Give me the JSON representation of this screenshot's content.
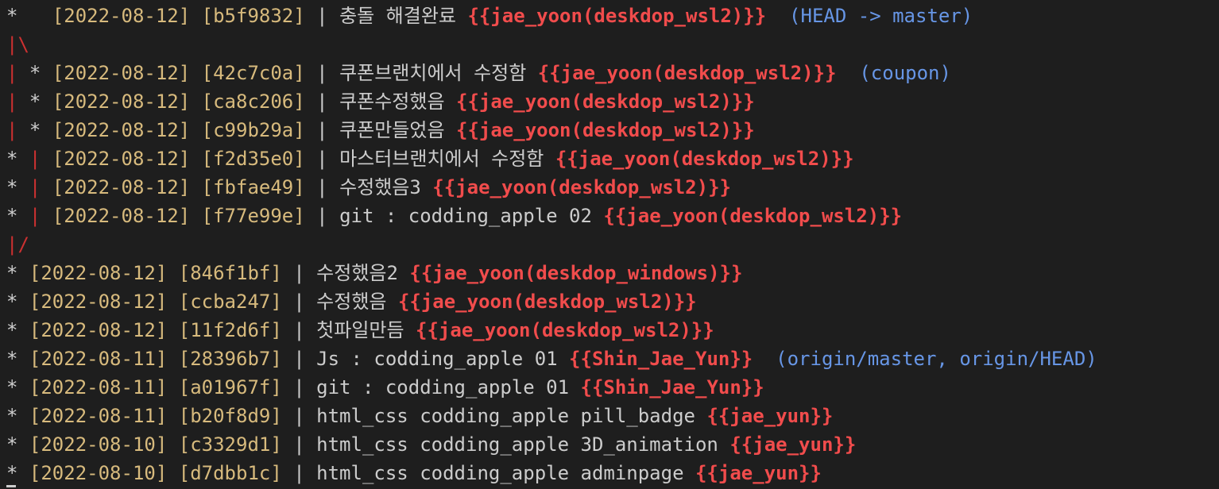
{
  "terminal": {
    "lines": [
      {
        "graph": "*  ",
        "graph_color": "default",
        "date": "[2022-08-12]",
        "hash": "[b5f9832]",
        "sep": "|",
        "message": "충돌 해결완료",
        "author": "{{jae_yoon(deskdop_wsl2)}}",
        "ref": "(HEAD -> master)"
      },
      {
        "graph": "|\\",
        "graph_color": "red",
        "date": "",
        "hash": "",
        "sep": "",
        "message": "",
        "author": "",
        "ref": ""
      },
      {
        "graph": "| *",
        "graph_color": "red-first",
        "date": "[2022-08-12]",
        "hash": "[42c7c0a]",
        "sep": "|",
        "message": "쿠폰브랜치에서 수정함",
        "author": "{{jae_yoon(deskdop_wsl2)}}",
        "ref": "(coupon)"
      },
      {
        "graph": "| *",
        "graph_color": "red-first",
        "date": "[2022-08-12]",
        "hash": "[ca8c206]",
        "sep": "|",
        "message": "쿠폰수정했음",
        "author": "{{jae_yoon(deskdop_wsl2)}}",
        "ref": ""
      },
      {
        "graph": "| *",
        "graph_color": "red-first",
        "date": "[2022-08-12]",
        "hash": "[c99b29a]",
        "sep": "|",
        "message": "쿠폰만들었음",
        "author": "{{jae_yoon(deskdop_wsl2)}}",
        "ref": ""
      },
      {
        "graph": "* |",
        "graph_color": "red-last",
        "date": "[2022-08-12]",
        "hash": "[f2d35e0]",
        "sep": "|",
        "message": "마스터브랜치에서 수정함",
        "author": "{{jae_yoon(deskdop_wsl2)}}",
        "ref": ""
      },
      {
        "graph": "* |",
        "graph_color": "red-last",
        "date": "[2022-08-12]",
        "hash": "[fbfae49]",
        "sep": "|",
        "message": "수정했음3",
        "author": "{{jae_yoon(deskdop_wsl2)}}",
        "ref": ""
      },
      {
        "graph": "* |",
        "graph_color": "red-last",
        "date": "[2022-08-12]",
        "hash": "[f77e99e]",
        "sep": "|",
        "message": "git : codding_apple 02",
        "author": "{{jae_yoon(deskdop_wsl2)}}",
        "ref": ""
      },
      {
        "graph": "|/",
        "graph_color": "red-last",
        "date": "",
        "hash": "",
        "sep": "",
        "message": "",
        "author": "",
        "ref": ""
      },
      {
        "graph": "*",
        "graph_color": "default",
        "date": "[2022-08-12]",
        "hash": "[846f1bf]",
        "sep": "|",
        "message": "수정했음2",
        "author": "{{jae_yoon(deskdop_windows)}}",
        "ref": ""
      },
      {
        "graph": "*",
        "graph_color": "default",
        "date": "[2022-08-12]",
        "hash": "[ccba247]",
        "sep": "|",
        "message": "수정했음",
        "author": "{{jae_yoon(deskdop_wsl2)}}",
        "ref": ""
      },
      {
        "graph": "*",
        "graph_color": "default",
        "date": "[2022-08-12]",
        "hash": "[11f2d6f]",
        "sep": "|",
        "message": "첫파일만듬",
        "author": "{{jae_yoon(deskdop_wsl2)}}",
        "ref": ""
      },
      {
        "graph": "*",
        "graph_color": "default",
        "date": "[2022-08-11]",
        "hash": "[28396b7]",
        "sep": "|",
        "message": "Js : codding_apple 01",
        "author": "{{Shin_Jae_Yun}}",
        "ref": "(origin/master, origin/HEAD)"
      },
      {
        "graph": "*",
        "graph_color": "default",
        "date": "[2022-08-11]",
        "hash": "[a01967f]",
        "sep": "|",
        "message": "git : codding_apple 01",
        "author": "{{Shin_Jae_Yun}}",
        "ref": ""
      },
      {
        "graph": "*",
        "graph_color": "default",
        "date": "[2022-08-11]",
        "hash": "[b20f8d9]",
        "sep": "|",
        "message": "html_css codding_apple pill_badge",
        "author": "{{jae_yun}}",
        "ref": ""
      },
      {
        "graph": "*",
        "graph_color": "default",
        "date": "[2022-08-10]",
        "hash": "[c3329d1]",
        "sep": "|",
        "message": "html_css codding_apple 3D_animation",
        "author": "{{jae_yun}}",
        "ref": ""
      },
      {
        "graph": "*",
        "graph_color": "default",
        "date": "[2022-08-10]",
        "hash": "[d7dbb1c]",
        "sep": "|",
        "message": "html_css codding_apple adminpage",
        "author": "{{jae_yun}}",
        "ref": ""
      }
    ]
  },
  "colors": {
    "background": "#1e1e1e",
    "text": "#cccccc",
    "date_hash": "#d7ba7d",
    "author": "#f14c4c",
    "ref": "#6796e6",
    "graph_branch": "#cd3131"
  }
}
